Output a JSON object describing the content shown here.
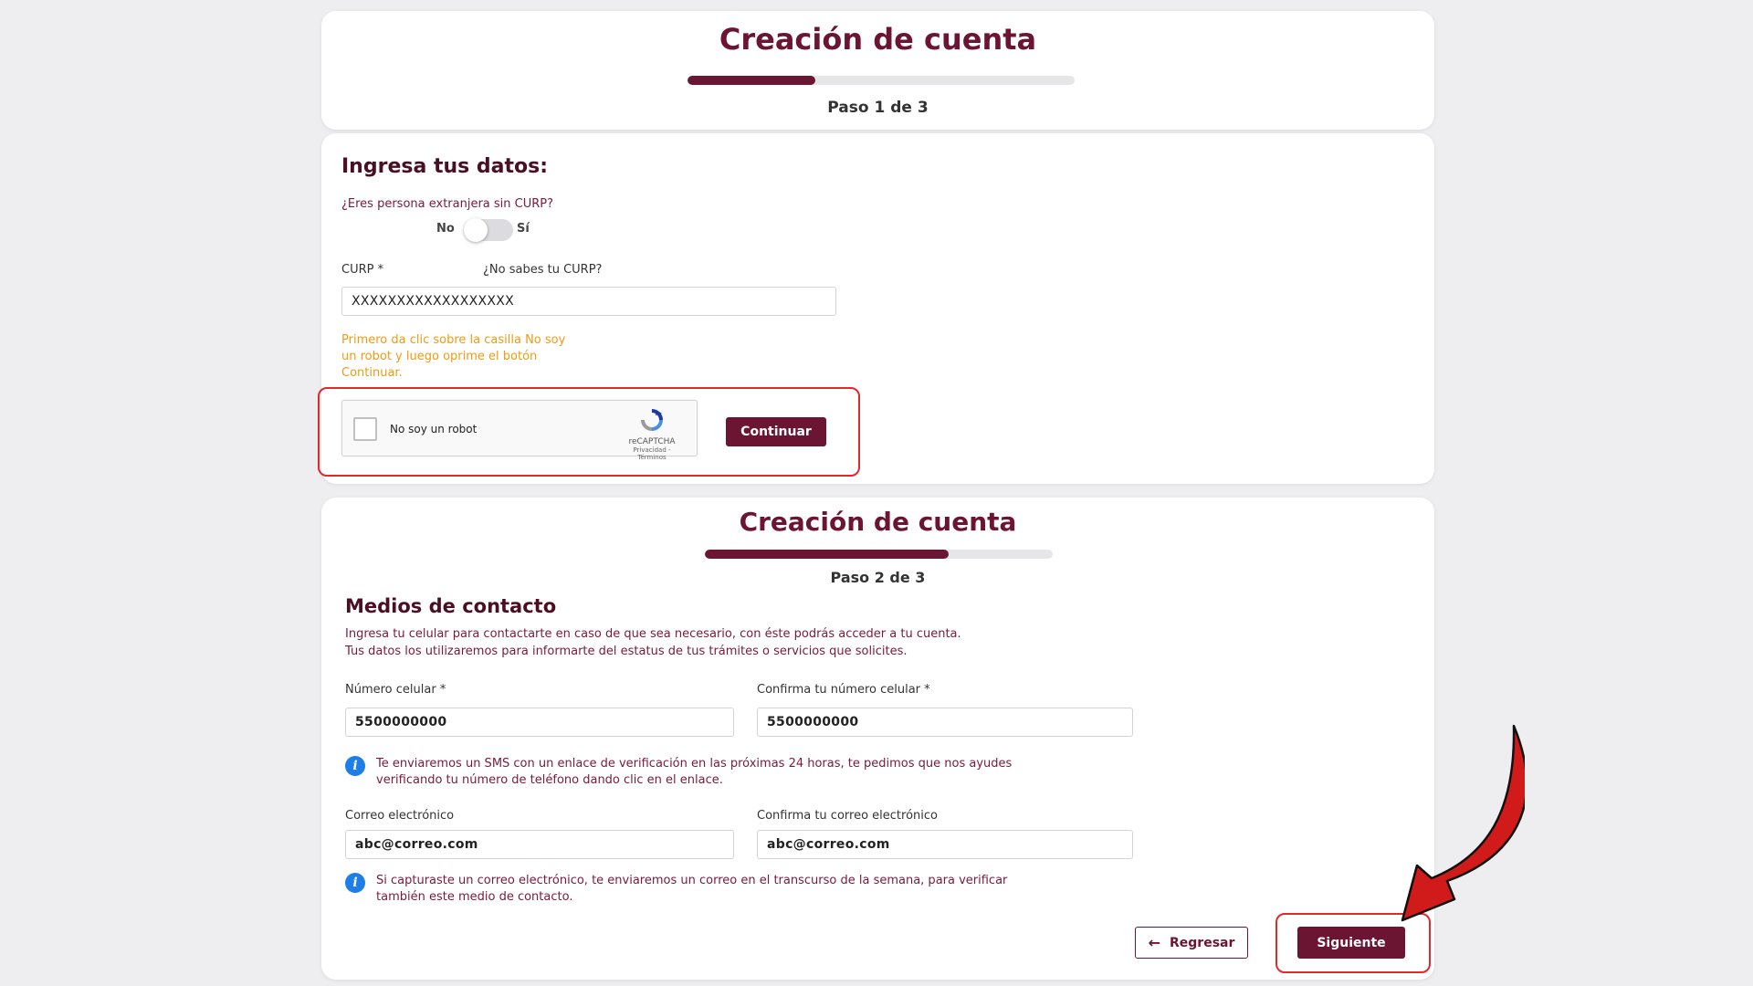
{
  "step1": {
    "title": "Creación de cuenta",
    "progress": 0.33,
    "step_label": "Paso 1 de 3",
    "section_title": "Ingresa tus datos:",
    "foreign_question": "¿Eres persona extranjera sin CURP?",
    "toggle_no": "No",
    "toggle_yes": "Sí",
    "curp_label": "CURP *",
    "curp_help_link": "¿No sabes tu CURP?",
    "curp_value": "XXXXXXXXXXXXXXXXXX",
    "instruction_line1": "Primero da clic sobre la casilla No soy",
    "instruction_line2": "un robot y luego oprime el botón",
    "instruction_line3": "Continuar.",
    "captcha": {
      "label": "No soy un robot",
      "brand": "reCAPTCHA",
      "links": "Privacidad - Términos"
    },
    "continue_label": "Continuar"
  },
  "step2": {
    "title": "Creación de cuenta",
    "progress": 0.7,
    "step_label": "Paso 2 de 3",
    "section_title": "Medios de contacto",
    "desc_line1": "Ingresa tu celular para contactarte en caso de que sea necesario, con éste podrás acceder a tu cuenta.",
    "desc_line2": "Tus datos los utilizaremos para informarte del estatus de tus trámites o servicios que solicites.",
    "phone_label": "Número celular *",
    "phone_value": "5500000000",
    "phone_confirm_label": "Confirma tu número celular *",
    "phone_confirm_value": "5500000000",
    "sms_info_line1": "Te enviaremos un SMS con un enlace de verificación en las próximas 24 horas, te pedimos que nos ayudes",
    "sms_info_line2": "verificando tu número de teléfono dando clic en el enlace.",
    "email_label": "Correo electrónico",
    "email_value": "abc@correo.com",
    "email_confirm_label": "Confirma tu correo electrónico",
    "email_confirm_value": "abc@correo.com",
    "email_info_line1": "Si capturaste un correo electrónico, te enviaremos un correo en el transcurso de la semana, para verificar",
    "email_info_line2": "también este medio de contacto.",
    "back_label": "Regresar",
    "next_label": "Siguiente"
  },
  "colors": {
    "brand": "#6b1532",
    "highlight": "#e0282f",
    "warning": "#f19a14",
    "info": "#1c7ee6",
    "arrow": "#d11a1a"
  },
  "icons": [
    "info-icon",
    "back-arrow-icon",
    "recaptcha-icon",
    "red-arrow-icon"
  ]
}
